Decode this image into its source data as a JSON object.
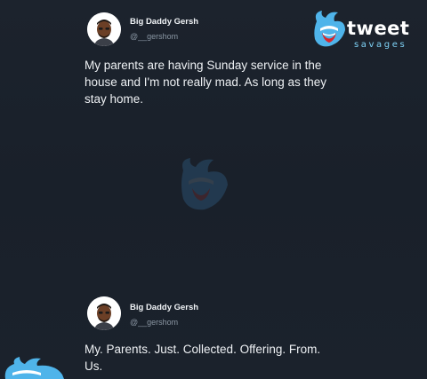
{
  "tweets": [
    {
      "name": "Big Daddy Gersh",
      "handle": "@__gershom",
      "text": "My parents are having Sunday service in the house and I'm not really mad. As long as they stay home."
    },
    {
      "name": "Big Daddy Gersh",
      "handle": "@__gershom",
      "text": "My. Parents. Just. Collected. Offering. From. Us."
    }
  ],
  "watermark": {
    "word1": "tweet",
    "word2": "savages",
    "icon": "bird-logo-icon"
  },
  "colors": {
    "background": "#1a212b",
    "text": "#eef1f4",
    "handle": "#8a96a3",
    "brand_blue": "#4fb4ea",
    "brand_red": "#d9262c"
  }
}
